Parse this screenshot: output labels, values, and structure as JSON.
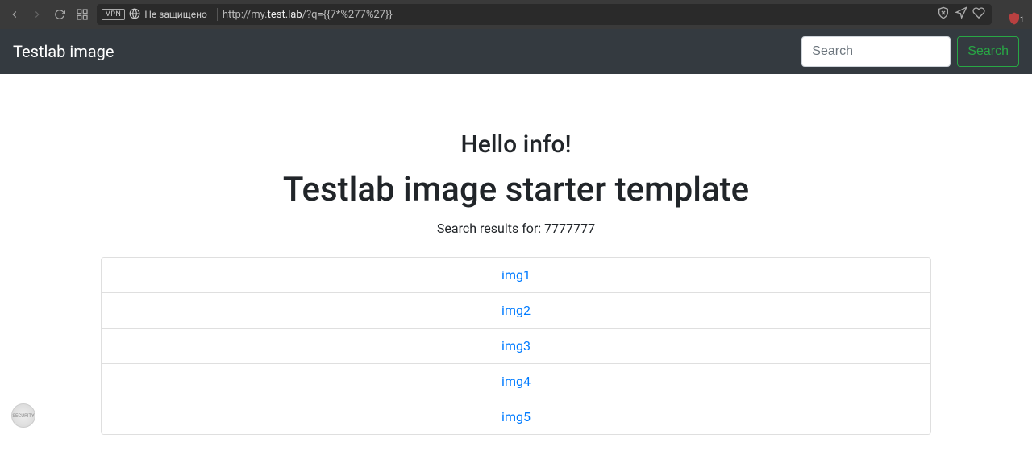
{
  "browser": {
    "vpn_label": "VPN",
    "security_text": "Не защищено",
    "url_prefix": "http://my.",
    "url_domain": "test.lab",
    "url_path": "/?q={{7*%277%27}}",
    "notification_count": "1"
  },
  "navbar": {
    "brand": "Testlab image",
    "search_placeholder": "Search",
    "search_button": "Search"
  },
  "main": {
    "hello": "Hello info!",
    "title": "Testlab image starter template",
    "results_label": "Search results for: ",
    "results_value": "7777777",
    "items": [
      {
        "label": "img1"
      },
      {
        "label": "img2"
      },
      {
        "label": "img3"
      },
      {
        "label": "img4"
      },
      {
        "label": "img5"
      }
    ]
  }
}
